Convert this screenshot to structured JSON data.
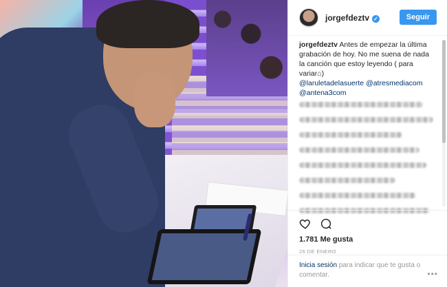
{
  "header": {
    "username": "jorgefdeztv",
    "follow_label": "Seguir"
  },
  "caption": {
    "username": "jorgefdeztv",
    "text": "Antes de empezar la última grabación de hoy. No me suena de nada la canción que estoy leyendo ( para variar⌂)",
    "mentions": [
      "@laruletadelasuerte",
      "@atresmediacom",
      "@antena3com"
    ]
  },
  "icons": {
    "like": "heart-icon",
    "comment": "comment-icon",
    "verified": "verified-badge-icon",
    "more": "more-options-icon"
  },
  "stats": {
    "likes": "1.781 Me gusta",
    "date": "26 DE ENERO"
  },
  "login": {
    "link": "Inicia sesión",
    "text": " para indicar que te gusta o comentar."
  },
  "colors": {
    "accent": "#3897f0",
    "link": "#003569",
    "muted": "#999999"
  }
}
